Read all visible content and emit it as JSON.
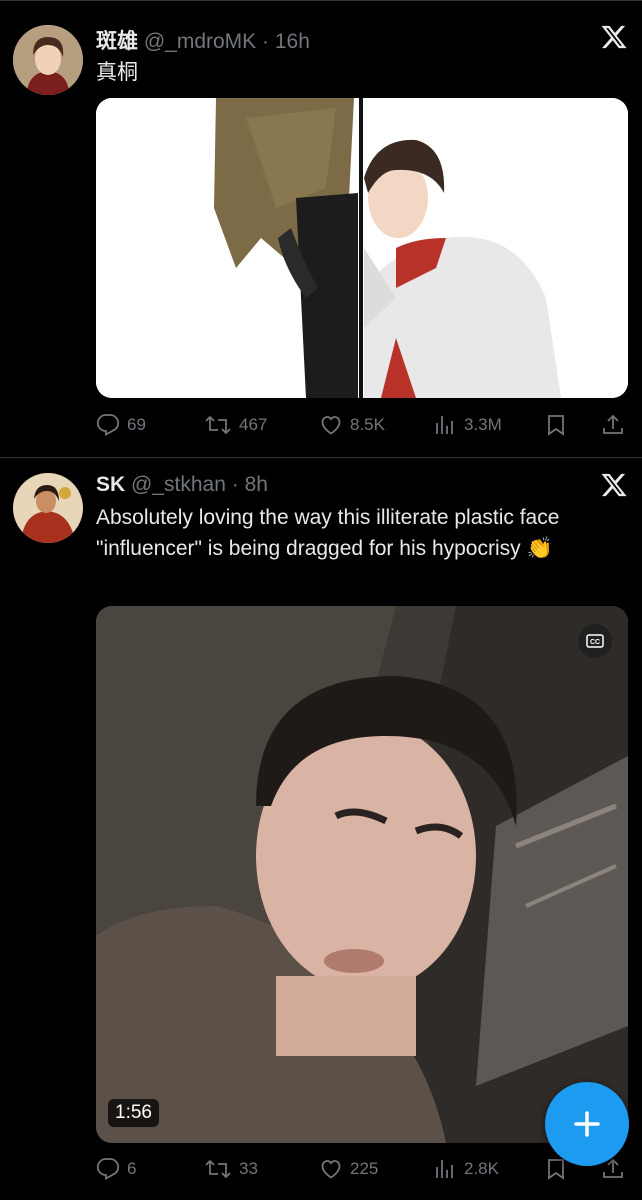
{
  "tweets": [
    {
      "author": {
        "name": "斑雄",
        "handle": "@_mdroMK",
        "time": "16h"
      },
      "text": "真桐",
      "media": {
        "type": "illustration"
      },
      "actions": {
        "replies": "69",
        "reposts": "467",
        "likes": "8.5K",
        "views": "3.3M"
      }
    },
    {
      "author": {
        "name": "SK",
        "handle": "@_stkhan",
        "time": "8h"
      },
      "text": "Absolutely loving the way this illiterate plastic face \"influencer\" is being dragged for his hypocrisy 👏",
      "media": {
        "type": "video",
        "duration": "1:56",
        "captions_icon": "cc-icon"
      },
      "actions": {
        "replies": "6",
        "reposts": "33",
        "likes": "225",
        "views": "2.8K"
      }
    }
  ],
  "separator": "·",
  "icons": [
    "x-logo-icon",
    "reply-icon",
    "repost-icon",
    "like-icon",
    "views-icon",
    "bookmark-icon",
    "share-icon",
    "plus-icon"
  ],
  "colors": {
    "background": "#000000",
    "text": "#e7e9ea",
    "muted": "#71767b",
    "accent": "#1d9bf0",
    "divider": "#2f3336"
  },
  "fab": {
    "icon": "plus-icon"
  }
}
